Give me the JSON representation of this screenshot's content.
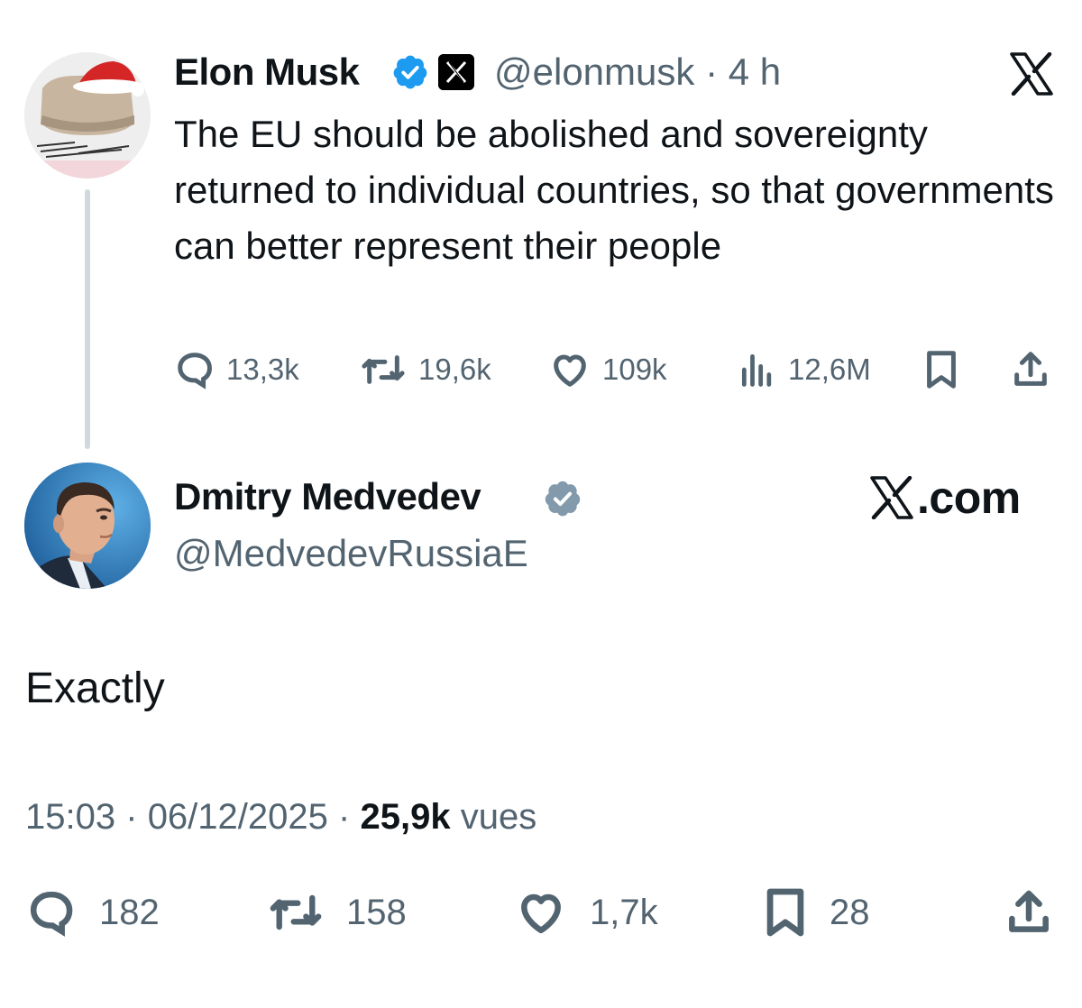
{
  "quoted_tweet": {
    "author_name": "Elon Musk",
    "handle": "@elonmusk",
    "separator": "·",
    "time": "4 h",
    "text": "The EU should be abolished and sovereignty returned to individual countries, so that governments can better represent their people",
    "metrics": {
      "replies": "13,3k",
      "reposts": "19,6k",
      "likes": "109k",
      "views": "12,6M"
    }
  },
  "main_tweet": {
    "author_name": "Dmitry Medvedev",
    "handle": "@MedvedevRussiaE",
    "brand_suffix": ".com",
    "text": "Exactly",
    "time": "15:03",
    "dot1": "·",
    "date": "06/12/2025",
    "dot2": "·",
    "views_count": "25,9k",
    "views_label": "vues",
    "metrics": {
      "replies": "182",
      "reposts": "158",
      "likes": "1,7k",
      "bookmarks": "28"
    }
  },
  "colors": {
    "text": "#0f1419",
    "secondary": "#536471",
    "verified_blue": "#1d9bf0",
    "verified_gray": "#829aab",
    "thread_line": "#cfd9de"
  },
  "icons": [
    "x-logo-icon",
    "verified-badge-icon",
    "reply-icon",
    "repost-icon",
    "like-icon",
    "views-icon",
    "bookmark-icon",
    "share-icon"
  ]
}
